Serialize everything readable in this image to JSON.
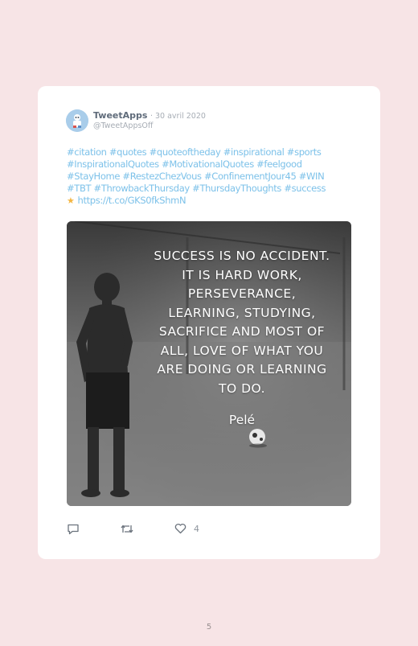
{
  "tweet": {
    "name": "TweetApps",
    "date": "· 30 avril 2020",
    "handle": "@TweetAppsOff",
    "text_lines": [
      "#citation #quotes #quoteoftheday #inspirational #sports",
      "#InspirationalQuotes #MotivationalQuotes #feelgood",
      "#StayHome #RestezChezVous #ConfinementJour45 #WIN",
      "#TBT #ThrowbackThursday #ThursdayThoughts #success"
    ],
    "link_icon": "star-emoji-icon",
    "link": "https://t.co/GKS0fkShmN",
    "media": {
      "quote_lines": [
        "SUCCESS IS NO ACCIDENT.",
        "IT IS HARD WORK,",
        "PERSEVERANCE,",
        "LEARNING, STUDYING,",
        "SACRIFICE AND MOST OF",
        "ALL, LOVE OF WHAT YOU",
        "ARE DOING OR LEARNING",
        "TO DO."
      ],
      "author": "Pelé"
    },
    "actions": {
      "reply_icon": "reply-icon",
      "retweet_icon": "retweet-icon",
      "like_icon": "heart-icon",
      "like_count": "4"
    }
  },
  "page_number": "5",
  "colors": {
    "page_background": "#f7e4e6",
    "card": "#ffffff",
    "hashtag": "#7cc1e9",
    "muted": "#a7adb5"
  }
}
